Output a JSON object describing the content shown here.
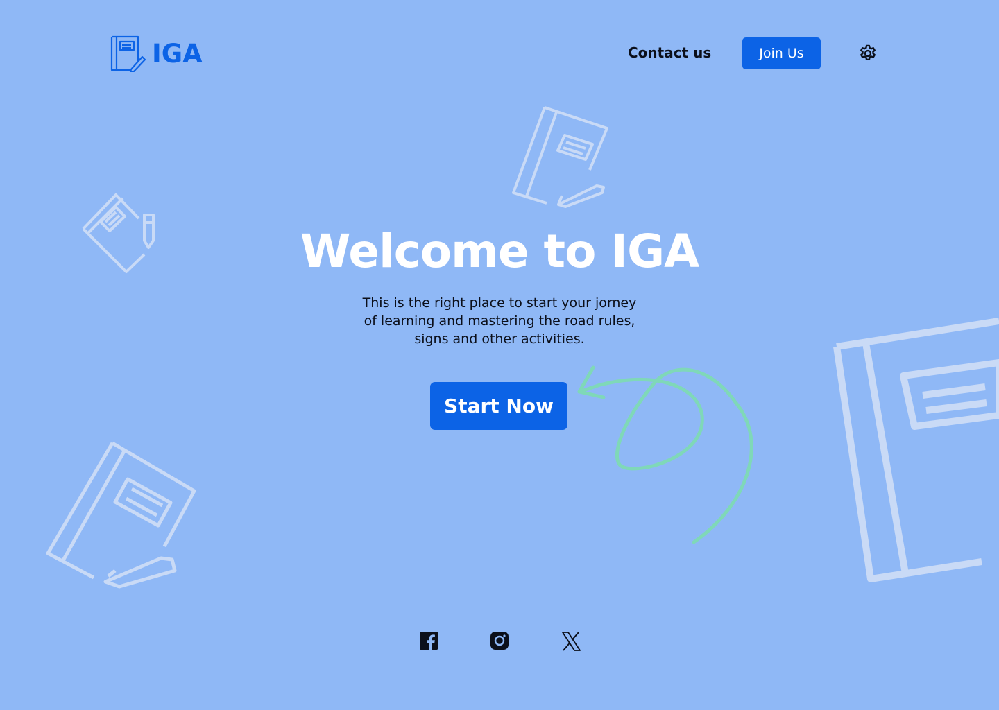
{
  "brand": {
    "name": "IGA",
    "logo_icon": "notebook-pencil-icon"
  },
  "nav": {
    "contact_label": "Contact us",
    "join_label": "Join Us",
    "settings_icon": "gear-icon"
  },
  "hero": {
    "title": "Welcome to IGA",
    "text_lines": [
      "This is the right place to start your jorney",
      "of learning and mastering the road rules,",
      "signs and other activities."
    ],
    "cta_label": "Start Now"
  },
  "social": [
    {
      "name": "facebook-icon"
    },
    {
      "name": "instagram-icon"
    },
    {
      "name": "x-icon"
    }
  ],
  "colors": {
    "background": "#8fb8f6",
    "accent": "#0c63e6",
    "arrow": "#7fd8b8",
    "doodle": "#c9daf6"
  }
}
